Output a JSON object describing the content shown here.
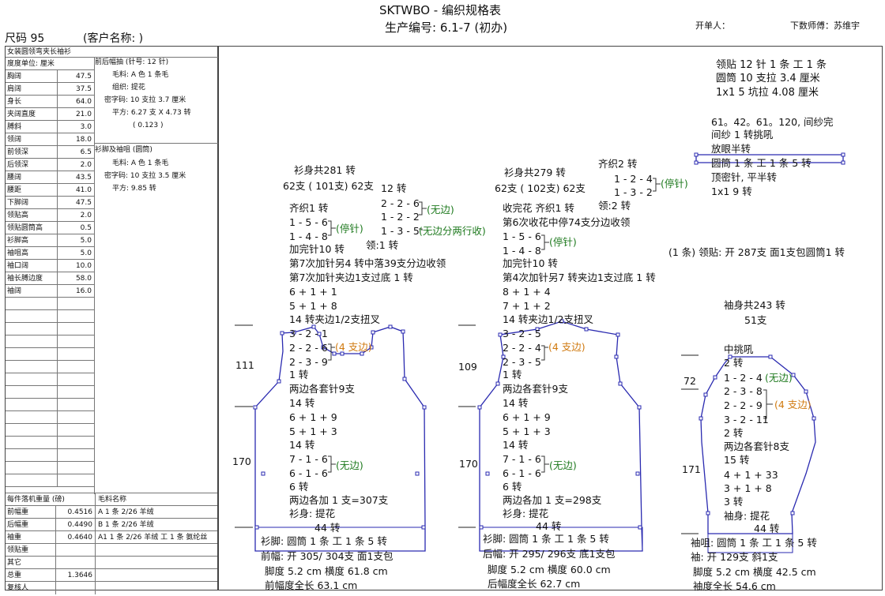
{
  "header": {
    "title": "SKTWBO - 编织规格表",
    "production_no": "生产编号: 6.1-7 (初办)",
    "issuer": "开单人：",
    "master": "下数师傅：苏维宇",
    "size": "尺码 95",
    "customer": "(客户名称: )"
  },
  "spec": {
    "style": "女装圆领弯夹长袖衫",
    "unit": "度度单位: 厘米",
    "rows": [
      {
        "label": "胸阔",
        "value": "47.5"
      },
      {
        "label": "肩阔",
        "value": "37.5"
      },
      {
        "label": "身长",
        "value": "64.0"
      },
      {
        "label": "夹阔直度",
        "value": "21.0"
      },
      {
        "label": "膊斜",
        "value": "3.0"
      },
      {
        "label": "领阔",
        "value": "18.0"
      },
      {
        "label": "前领深",
        "value": "6.5"
      },
      {
        "label": "后领深",
        "value": "2.0"
      },
      {
        "label": "腰阔",
        "value": "43.5"
      },
      {
        "label": "腰距",
        "value": "41.0"
      },
      {
        "label": "下脚阔",
        "value": "47.5"
      },
      {
        "label": "领贴高",
        "value": "2.0"
      },
      {
        "label": "领贴圆筒高",
        "value": "0.5"
      },
      {
        "label": "衫脚高",
        "value": "5.0"
      },
      {
        "label": "袖咀高",
        "value": "5.0"
      },
      {
        "label": "袖口阔",
        "value": "10.0"
      },
      {
        "label": "袖长膊边度",
        "value": "58.0"
      },
      {
        "label": "袖阔",
        "value": "16.0"
      }
    ],
    "yarn": {
      "front_back_title": "前后幅抽 (针号: 12 针)",
      "front_back": [
        "毛料: A 色 1 条毛",
        "组织: 提花",
        "密字码: 10 支拉 3.7 厘米",
        "平方: 6.27 支 X 4.73 转",
        "( 0.123 )"
      ],
      "hem_title": "衫脚及袖咀 (圆筒)",
      "hem": [
        "毛料: A 色 1 条毛",
        "密字码: 10 支拉 3.5 厘米",
        "平方: 9.85 转"
      ]
    },
    "weights_header": [
      "每件落机重量 (磅)",
      "毛料名称"
    ],
    "weights": [
      {
        "label": "前幅重",
        "value": "0.4516",
        "yarn": "A  1 条 2/26 羊绒"
      },
      {
        "label": "后幅重",
        "value": "0.4490",
        "yarn": "B  1 条 2/26 羊绒"
      },
      {
        "label": "袖重",
        "value": "0.4640",
        "yarn": "A1  1 条 2/26 羊绒 ⼯ 1 条 氨纶丝"
      },
      {
        "label": "领贴重",
        "value": "",
        "yarn": ""
      },
      {
        "label": "其它",
        "value": "",
        "yarn": ""
      },
      {
        "label": "总重",
        "value": "1.3646",
        "yarn": ""
      },
      {
        "label": "复核人",
        "value": "",
        "yarn": ""
      }
    ]
  },
  "collar": {
    "lines": [
      "领贴  12 针 1 条 ⼯ 1 条",
      "圆筒 10 支拉 3.4 厘米",
      "1x1   5 坑拉 4.08 厘米"
    ],
    "lines2": [
      "61。42。61。120, 间纱完",
      "间纱 1 转挑吼",
      "放眼半转",
      "圆筒 1 条 ⼯ 1 条       5 转",
      "顶密针, 平半转",
      "1x1        9 转"
    ],
    "note": "(1 条) 领贴: 开 287支 面1支包圆筒1 转"
  },
  "front": {
    "total": "衫身共281 转",
    "needles": "62支 ( 101支) 62支",
    "t12": "12 转",
    "n226": "2 - 2 - 6",
    "n122": "1 - 2 - 2",
    "n135": "1 - 3 - 5",
    "free": "(无边)",
    "free2": "(无边分两行收)",
    "qizhi": "齐织1 转",
    "n156": "1 - 5 - 6",
    "n148": "1 - 4 - 8",
    "stop": "(停针)",
    "ling": "领:1 转",
    "jiawan": "加完针10 转",
    "l7a": "第7次加针另4 转中落39支分边收领",
    "l7b": "第7次加针夹边1支过底 1 转",
    "s611": "6 + 1 + 1",
    "s518": "5 + 1 + 8",
    "twist": "14 转夹边1/2支扭叉",
    "n321": "3 - 2 - 1",
    "n226b": "2 - 2 - 6",
    "n239": "2 - 3 - 9",
    "four": "(4 支边)",
    "t1": "1 转",
    "taozhen": "两边各套针9支",
    "t14a": "14 转",
    "s619": "6 + 1 + 9",
    "s513": "5 + 1 + 3",
    "t14b": "14 转",
    "n716": "7 - 1 - 6",
    "n616": "6 - 1 - 6",
    "t6": "6 转",
    "add": "两边各加 1 支=307支",
    "body": "衫身: 提花",
    "t44": "44 转",
    "hem": "衫脚: 圆筒  1 条 ⼯ 1 条 5 转",
    "open": "前幅: 开 305/ 304支 面1支包",
    "foot": "脚度 5.2 cm  横度 61.8 cm",
    "len": "前幅度全长 63.1 cm",
    "dim111": "111",
    "dim170": "170"
  },
  "back": {
    "total": "衫身共279 转",
    "needles": "62支 ( 102支) 62支",
    "qizhi2": "齐织2 转",
    "n124": "1 - 2 - 4",
    "n132": "1 - 3 - 2",
    "stop": "(停针)",
    "ling2": "领:2 转",
    "flower": "收完花 齐织1 转",
    "l6": "第6次收花中停74支分边收领",
    "n156": "1 - 5 - 6",
    "n148": "1 - 4 - 8",
    "stop2": "(停针)",
    "jiawan": "加完针10 转",
    "l4": "第4次加针另7 转夹边1支过底 1 转",
    "s814": "8 + 1 + 4",
    "s712": "7 + 1 + 2",
    "twist": "14 转夹边1/2支扭叉",
    "n325": "3 - 2 - 5",
    "n224": "2 - 2 - 4",
    "n235": "2 - 3 - 5",
    "four": "(4 支边)",
    "t1": "1 转",
    "taozhen": "两边各套针9支",
    "t14a": "14 转",
    "s619": "6 + 1 + 9",
    "s513": "5 + 1 + 3",
    "t14b": "14 转",
    "n716": "7 - 1 - 6",
    "n616": "6 - 1 - 6",
    "free": "(无边)",
    "t6": "6 转",
    "add": "两边各加 1 支=298支",
    "body": "衫身: 提花",
    "t44": "44 转",
    "hem": "衫脚: 圆筒  1 条 ⼯ 1 条 5 转",
    "open": "后幅: 开 295/ 296支 底1支包",
    "foot": "脚度 5.2 cm  横度 60.0 cm",
    "len": "后幅度全长 62.7 cm",
    "dim109": "109",
    "dim170": "170"
  },
  "sleeve": {
    "total": "袖身共243 转",
    "needles": "51支",
    "zhong": "中挑吼",
    "t2a": "2 转",
    "n124": "1 - 2 - 4",
    "free": "(无边)",
    "n238": "2 - 3 - 8",
    "n229": "2 - 2 - 9",
    "n3211": "3 - 2 - 11",
    "four": "(4 支边)",
    "t2b": "2 转",
    "taozhen": "两边各套针8支",
    "t15": "15 转",
    "s4133": "4 + 1 + 33",
    "s318": "3 + 1 + 8",
    "t3": "3 转",
    "body": "袖身: 提花",
    "t44": "44 转",
    "cuff": "袖咀: 圆筒  1 条 ⼯ 1 条 5 转",
    "open": "袖: 开 129支 斜1支",
    "foot": "脚度 5.2 cm  横度 42.5 cm",
    "len": "袖度全长 54.6 cm",
    "dim72": "72",
    "dim171": "171"
  }
}
